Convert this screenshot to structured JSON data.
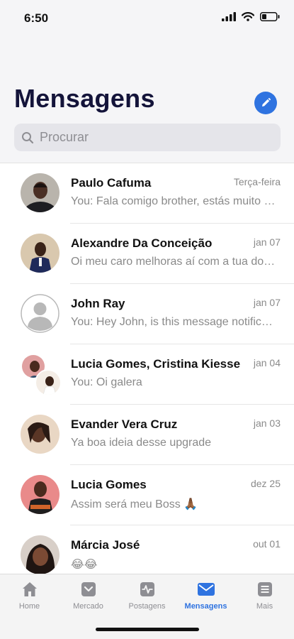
{
  "status_bar": {
    "time": "6:50"
  },
  "header": {
    "title": "Mensagens",
    "compose_icon": "pencil-icon"
  },
  "search": {
    "placeholder": "Procurar"
  },
  "conversations": [
    {
      "name": "Paulo Cafuma",
      "date": "Terça-feira",
      "preview": "You: Fala comigo brother, estás muito bem?"
    },
    {
      "name": "Alexandre Da Conceição",
      "date": "jan 07",
      "preview": "Oi meu caro melhoras aí com a tua doença"
    },
    {
      "name": "John Ray",
      "date": "jan 07",
      "preview": "You: Hey John, is this message notification working?"
    },
    {
      "name": "Lucia Gomes, Cristina Kiesse",
      "date": "jan 04",
      "preview": "You: Oi galera"
    },
    {
      "name": "Evander Vera Cruz",
      "date": "jan 03",
      "preview": "Ya boa ideia desse upgrade"
    },
    {
      "name": "Lucia Gomes",
      "date": "dez 25",
      "preview": "Assim será meu Boss 🙏🏾"
    },
    {
      "name": "Márcia José",
      "date": "out 01",
      "preview": "😂😂"
    }
  ],
  "tab_bar": {
    "items": [
      {
        "label": "Home",
        "icon": "home-icon"
      },
      {
        "label": "Mercado",
        "icon": "store-icon"
      },
      {
        "label": "Postagens",
        "icon": "activity-icon"
      },
      {
        "label": "Mensagens",
        "icon": "mail-icon"
      },
      {
        "label": "Mais",
        "icon": "list-icon"
      }
    ],
    "active": "Mensagens"
  },
  "colors": {
    "accent": "#2f73e0",
    "title": "#14143a",
    "muted": "#8a8a8a",
    "tab_bg": "#f4f4f4"
  }
}
